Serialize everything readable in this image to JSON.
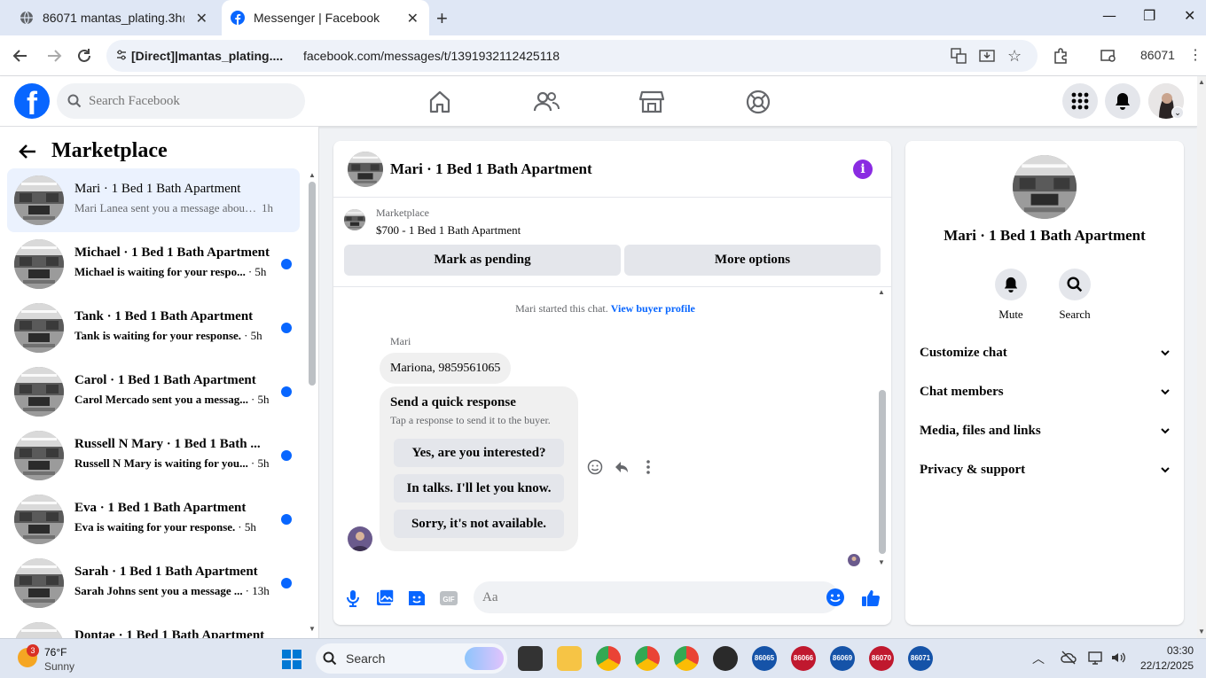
{
  "browser": {
    "tabs": [
      {
        "title": "86071 mantas_plating.3h@",
        "active": false
      },
      {
        "title": "Messenger | Facebook",
        "active": true
      }
    ],
    "site_chip": "[Direct]|mantas_plating....",
    "url": "facebook.com/messages/t/1391932112425118",
    "profile_label": "86071"
  },
  "fb_nav": {
    "logo": "f",
    "search_placeholder": "Search Facebook"
  },
  "left": {
    "title": "Marketplace",
    "conversations": [
      {
        "name": "Mari · 1 Bed 1 Bath Apartment",
        "snippet": "Mari Lanea sent you a message about ...",
        "time": "1h",
        "unread": false,
        "active": true
      },
      {
        "name": "Michael · 1 Bed 1 Bath Apartment",
        "snippet": "Michael is waiting for your respo...",
        "time": "· 5h",
        "unread": true
      },
      {
        "name": "Tank · 1 Bed 1 Bath Apartment",
        "snippet": "Tank is waiting for your response.",
        "time": "· 5h",
        "unread": true
      },
      {
        "name": "Carol · 1 Bed 1 Bath Apartment",
        "snippet": "Carol Mercado sent you a messag...",
        "time": "· 5h",
        "unread": true
      },
      {
        "name": "Russell N Mary · 1 Bed 1 Bath ...",
        "snippet": "Russell N Mary is waiting for you...",
        "time": "· 5h",
        "unread": true
      },
      {
        "name": "Eva · 1 Bed 1 Bath Apartment",
        "snippet": "Eva is waiting for your response.",
        "time": "· 5h",
        "unread": true
      },
      {
        "name": "Sarah · 1 Bed 1 Bath Apartment",
        "snippet": "Sarah Johns sent you a message ...",
        "time": "· 13h",
        "unread": true
      },
      {
        "name": "Dontae · 1 Bed 1 Bath Apartment",
        "snippet": "",
        "time": "",
        "unread": true
      }
    ]
  },
  "chat": {
    "title": "Mari · 1 Bed 1 Bath Apartment",
    "listing_label": "Marketplace",
    "listing_price": "$700 - 1 Bed 1 Bath Apartment",
    "mark_pending": "Mark as pending",
    "more_options": "More options",
    "started": "Mari started this chat.",
    "view_profile": "View buyer profile",
    "sender": "Mari",
    "message": "Mariona, 9859561065",
    "quick_title": "Send a quick response",
    "quick_sub": "Tap a response to send it to the buyer.",
    "quick_replies": [
      "Yes, are you interested?",
      "In talks. I'll let you know.",
      "Sorry, it's not available."
    ],
    "input_placeholder": "Aa"
  },
  "right": {
    "name": "Mari · 1 Bed 1 Bath Apartment",
    "mute": "Mute",
    "search": "Search",
    "sections": [
      "Customize chat",
      "Chat members",
      "Media, files and links",
      "Privacy & support"
    ]
  },
  "taskbar": {
    "temp": "76°F",
    "weather": "Sunny",
    "badge": "3",
    "search": "Search",
    "apps": [
      "86065",
      "86066",
      "86069",
      "86070",
      "86071"
    ],
    "time": "03:30",
    "date": "22/12/2025"
  },
  "colors": {
    "fb_blue": "#0866ff",
    "accent_purple": "#8a2be2",
    "active_row": "#ebf2fe"
  }
}
